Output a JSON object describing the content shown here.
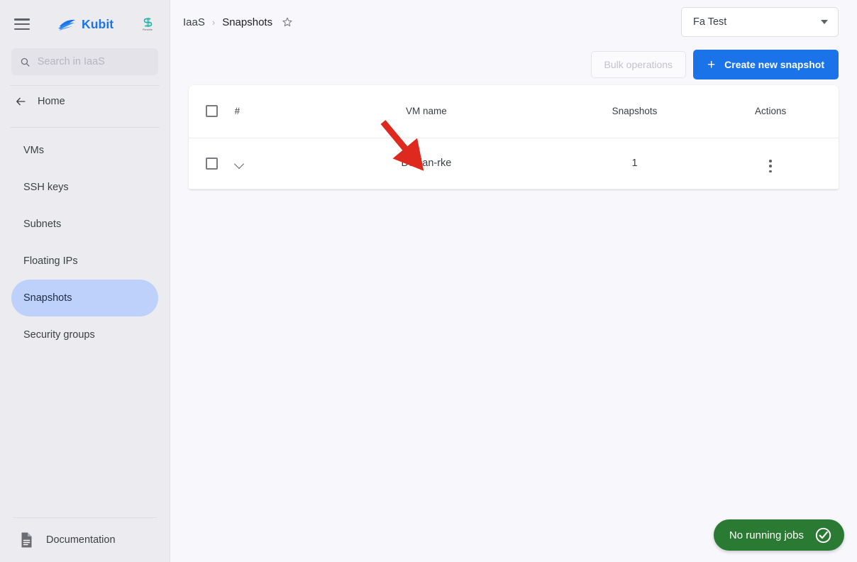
{
  "sidebar": {
    "menu_icon": "hamburger-icon",
    "brand": {
      "name": "Kubit",
      "mark": "wave-logo-icon"
    },
    "partner_logo": {
      "mark": "partner-s-logo-icon",
      "caption": "Flexible"
    },
    "search": {
      "value": "",
      "placeholder": "Search in IaaS",
      "icon": "search-icon"
    },
    "home": {
      "label": "Home",
      "icon": "arrow-left-icon"
    },
    "items": [
      {
        "label": "VMs",
        "active": false
      },
      {
        "label": "SSH keys",
        "active": false
      },
      {
        "label": "Subnets",
        "active": false
      },
      {
        "label": "Floating IPs",
        "active": false
      },
      {
        "label": "Snapshots",
        "active": true
      },
      {
        "label": "Security groups",
        "active": false
      }
    ],
    "documentation": {
      "label": "Documentation",
      "icon": "document-icon"
    }
  },
  "header": {
    "breadcrumb": [
      "IaaS",
      "Snapshots"
    ],
    "breadcrumb_separator": "›",
    "favorite_icon": "star-outline-icon",
    "project_select": {
      "value": "Fa Test",
      "icon": "chevron-down-icon"
    }
  },
  "toolbar": {
    "bulk_label": "Bulk operations",
    "bulk_disabled": true,
    "create_label": "Create new snapshot",
    "create_icon": "plus-icon"
  },
  "table": {
    "columns": [
      "",
      "#",
      "VM name",
      "Snapshots",
      "Actions"
    ],
    "header_checkbox_checked": false,
    "rows": [
      {
        "checked": false,
        "expand_icon": "chevron-down-icon",
        "vm_name": "Debian-rke",
        "snapshots": "1",
        "actions_icon": "more-vertical-icon"
      }
    ]
  },
  "annotation": {
    "arrow_color": "#de2a1e",
    "type": "pointer-arrow"
  },
  "status": {
    "jobs_label": "No running jobs",
    "jobs_icon": "check-circle-icon",
    "jobs_color": "#2b7a33"
  }
}
